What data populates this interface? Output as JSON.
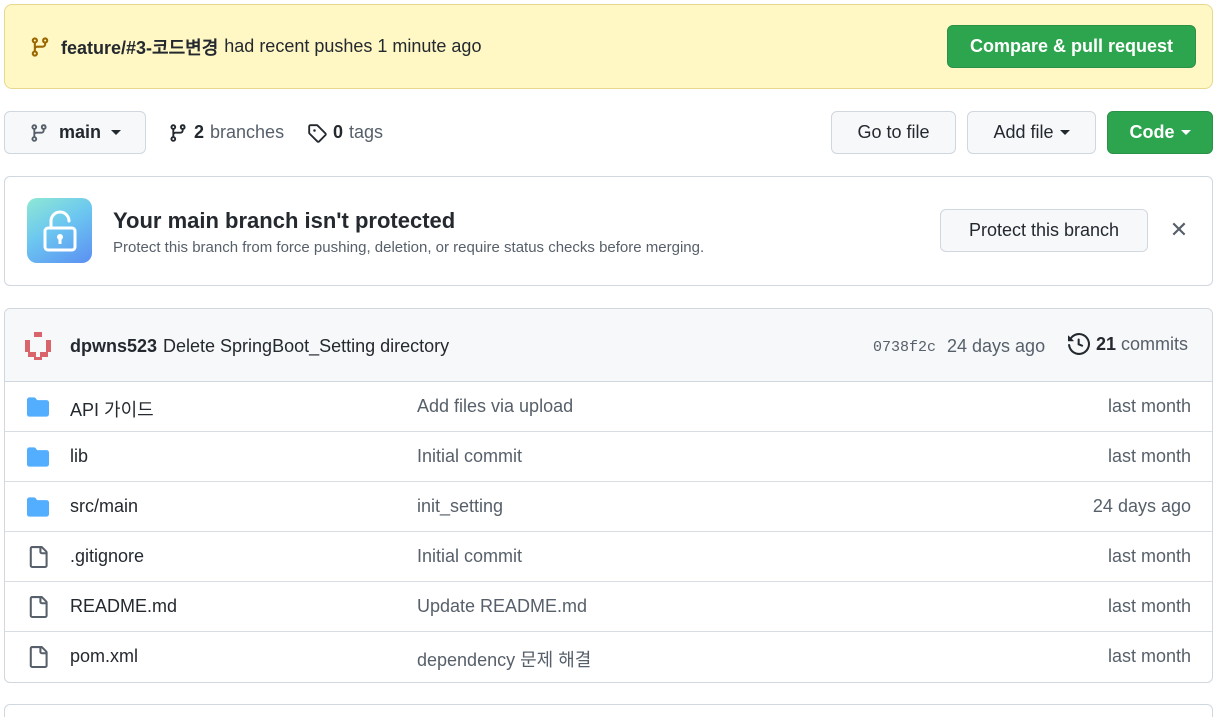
{
  "push_banner": {
    "branch": "feature/#3-코드변경",
    "text": "had recent pushes 1 minute ago",
    "button": "Compare & pull request"
  },
  "toolbar": {
    "branch": "main",
    "branches_count": "2",
    "branches_label": "branches",
    "tags_count": "0",
    "tags_label": "tags",
    "go_to_file": "Go to file",
    "add_file": "Add file",
    "code": "Code"
  },
  "protection": {
    "title": "Your main branch isn't protected",
    "description": "Protect this branch from force pushing, deletion, or require status checks before merging.",
    "button": "Protect this branch",
    "close": "✕"
  },
  "latest_commit": {
    "author": "dpwns523",
    "message": "Delete SpringBoot_Setting directory",
    "sha": "0738f2c",
    "age": "24 days ago",
    "commits_count": "21",
    "commits_label": "commits"
  },
  "files": [
    {
      "type": "dir",
      "name": "API 가이드",
      "message": "Add files via upload",
      "date": "last month"
    },
    {
      "type": "dir",
      "name": "lib",
      "message": "Initial commit",
      "date": "last month"
    },
    {
      "type": "dir",
      "name": "src/main",
      "message": "init_setting",
      "date": "24 days ago"
    },
    {
      "type": "file",
      "name": ".gitignore",
      "message": "Initial commit",
      "date": "last month"
    },
    {
      "type": "file",
      "name": "README.md",
      "message": "Update README.md",
      "date": "last month"
    },
    {
      "type": "file",
      "name": "pom.xml",
      "message": "dependency 문제 해결",
      "date": "last month"
    }
  ],
  "colors": {
    "banner_bg": "#fff8c5",
    "green": "#2da44e",
    "folder": "#54aeff"
  },
  "icons": {
    "branch": "git-branch-icon",
    "tag": "tag-icon",
    "history": "history-icon",
    "folder": "folder-icon",
    "file": "file-icon",
    "lock": "unlock-icon"
  }
}
